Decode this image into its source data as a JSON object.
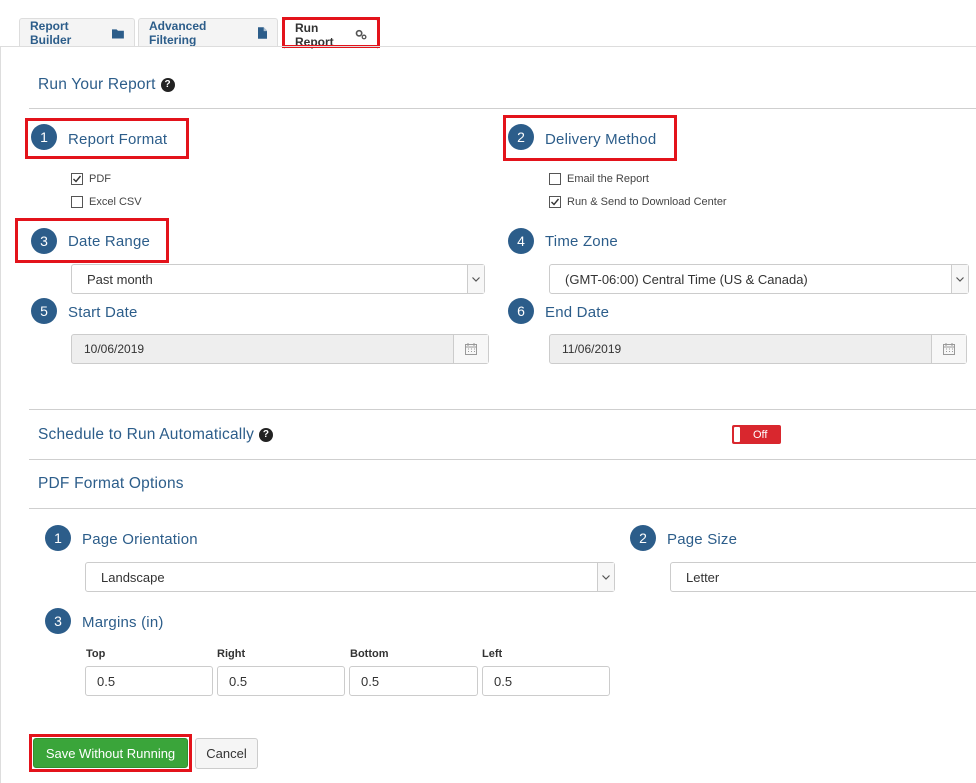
{
  "tabs": [
    {
      "label": "Report Builder",
      "icon": "folder-icon"
    },
    {
      "label": "Advanced Filtering",
      "icon": "file-icon"
    },
    {
      "label": "Run Report",
      "icon": "gears-icon"
    }
  ],
  "run": {
    "title": "Run Your Report",
    "report_format": {
      "number": "1",
      "label": "Report Format",
      "options": [
        {
          "label": "PDF",
          "checked": true
        },
        {
          "label": "Excel CSV",
          "checked": false
        }
      ]
    },
    "delivery_method": {
      "number": "2",
      "label": "Delivery Method",
      "options": [
        {
          "label": "Email the Report",
          "checked": false
        },
        {
          "label": "Run & Send to Download Center",
          "checked": true
        }
      ]
    },
    "date_range": {
      "number": "3",
      "label": "Date Range",
      "value": "Past month"
    },
    "time_zone": {
      "number": "4",
      "label": "Time Zone",
      "value": "(GMT-06:00) Central Time (US & Canada)"
    },
    "start_date": {
      "number": "5",
      "label": "Start Date",
      "value": "10/06/2019"
    },
    "end_date": {
      "number": "6",
      "label": "End Date",
      "value": "11/06/2019"
    }
  },
  "schedule": {
    "label": "Schedule to Run Automatically",
    "toggle": "Off"
  },
  "pdf": {
    "title": "PDF Format Options",
    "orientation": {
      "number": "1",
      "label": "Page Orientation",
      "value": "Landscape"
    },
    "size": {
      "number": "2",
      "label": "Page Size",
      "value": "Letter"
    },
    "margins": {
      "number": "3",
      "label": "Margins (in)",
      "top_label": "Top",
      "top": "0.5",
      "right_label": "Right",
      "right": "0.5",
      "bottom_label": "Bottom",
      "bottom": "0.5",
      "left_label": "Left",
      "left": "0.5"
    }
  },
  "buttons": {
    "save": "Save Without Running",
    "cancel": "Cancel"
  },
  "colors": {
    "accent": "#2c5d8a",
    "highlight": "#e3131b",
    "save": "#3aa53a",
    "toggle_off": "#d9272e"
  }
}
